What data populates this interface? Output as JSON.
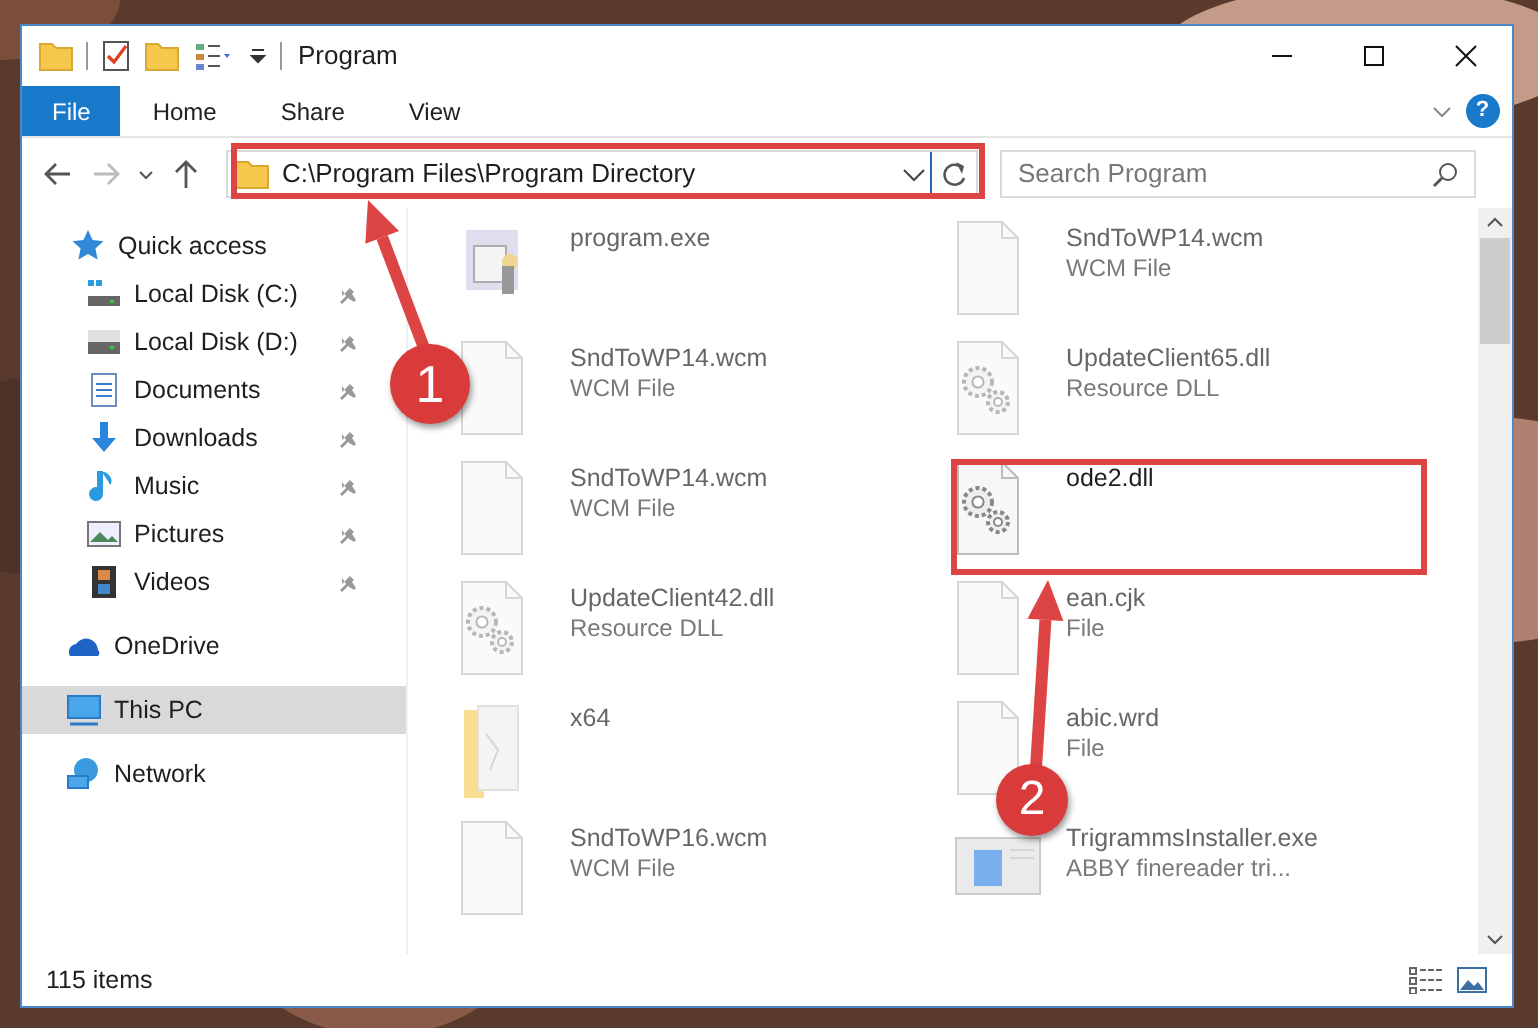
{
  "window": {
    "title": "Program"
  },
  "ribbon": {
    "tabs": [
      {
        "label": "File",
        "selected": true
      },
      {
        "label": "Home",
        "selected": false
      },
      {
        "label": "Share",
        "selected": false
      },
      {
        "label": "View",
        "selected": false
      }
    ],
    "help": "?"
  },
  "address_bar": {
    "path": "C:\\Program Files\\Program Directory"
  },
  "search": {
    "placeholder": "Search Program"
  },
  "navigation": {
    "items": [
      {
        "label": "Quick access",
        "kind": "star",
        "selected": false,
        "children": [
          {
            "label": "Local Disk (C:)",
            "kind": "drive-system",
            "pinned": true
          },
          {
            "label": "Local Disk (D:)",
            "kind": "drive",
            "pinned": true
          },
          {
            "label": "Documents",
            "kind": "documents",
            "pinned": true
          },
          {
            "label": "Downloads",
            "kind": "downloads",
            "pinned": true
          },
          {
            "label": "Music",
            "kind": "music",
            "pinned": true
          },
          {
            "label": "Pictures",
            "kind": "pictures",
            "pinned": true
          },
          {
            "label": "Videos",
            "kind": "videos",
            "pinned": true
          }
        ]
      },
      {
        "label": "OneDrive",
        "kind": "cloud",
        "selected": false
      },
      {
        "label": "This PC",
        "kind": "pc",
        "selected": true
      },
      {
        "label": "Network",
        "kind": "network",
        "selected": false
      }
    ]
  },
  "files": [
    {
      "name": "program.exe",
      "kind": "exe",
      "blurred": true
    },
    {
      "name": "SndToWP14.wcm",
      "type": "WCM File",
      "kind": "file",
      "blurred": true
    },
    {
      "name": "SndToWP14.wcm",
      "type": "WCM File",
      "kind": "file",
      "blurred": true
    },
    {
      "name": "UpdateClient65.dll",
      "type": "Resource DLL",
      "kind": "dll",
      "blurred": true
    },
    {
      "name": "SndToWP14.wcm",
      "type": "WCM File",
      "kind": "file",
      "blurred": true
    },
    {
      "name": "ode2.dll",
      "kind": "dll",
      "blurred": false
    },
    {
      "name": "UpdateClient42.dll",
      "type": "Resource DLL",
      "kind": "dll",
      "blurred": true
    },
    {
      "name": "ean.cjk",
      "type": "File",
      "kind": "file",
      "blurred": true
    },
    {
      "name": "x64",
      "kind": "folder",
      "blurred": true
    },
    {
      "name": "abic.wrd",
      "type": "File",
      "kind": "file",
      "blurred": true
    },
    {
      "name": "SndToWP16.wcm",
      "type": "WCM File",
      "kind": "file",
      "blurred": true
    },
    {
      "name": "TrigrammsInstaller.exe",
      "type": "ABBY finereader tri...",
      "kind": "installer",
      "blurred": true
    }
  ],
  "annotations": [
    {
      "number": "1"
    },
    {
      "number": "2"
    }
  ],
  "status_bar": {
    "item_count": "115 items"
  }
}
